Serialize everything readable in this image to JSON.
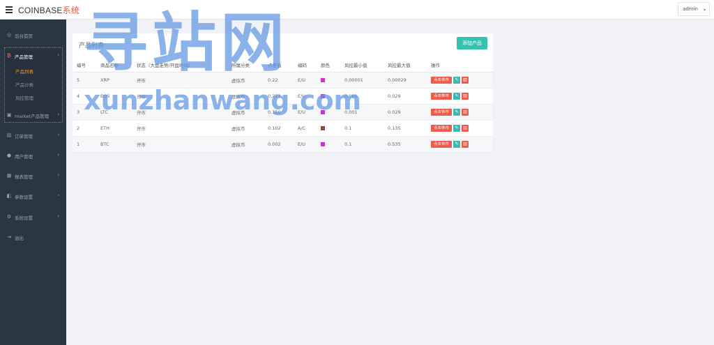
{
  "header": {
    "menu_icon": "hamburger-icon",
    "brand_en": "COINBASE",
    "brand_cn": "系统",
    "brand_cn_color": "#e8573f",
    "user": "admin"
  },
  "sidebar": {
    "items": [
      {
        "label": "后台首页",
        "icon": "dashboard-icon"
      },
      {
        "label": "产品管理",
        "icon": "bitcoin-icon",
        "active": true
      },
      {
        "label": "market产品管理",
        "icon": "stack-icon"
      },
      {
        "label": "订单管理",
        "icon": "orders-icon"
      },
      {
        "label": "用户管理",
        "icon": "user-icon"
      },
      {
        "label": "报表管理",
        "icon": "report-icon"
      },
      {
        "label": "参数设置",
        "icon": "params-icon"
      },
      {
        "label": "系统设置",
        "icon": "settings-icon"
      },
      {
        "label": "退出",
        "icon": "logout-icon"
      }
    ],
    "sub_items": [
      {
        "label": "产品列表",
        "current": true
      },
      {
        "label": "产品分类"
      },
      {
        "label": "风控管理"
      }
    ]
  },
  "panel": {
    "title": "产品列表",
    "add_button": "添加产品",
    "columns": [
      "编号",
      "商品名称",
      "状态（大盘走势/开盘时间）",
      "所属分类",
      "点差值",
      "编码",
      "颜色",
      "风控最小值",
      "风控最大值",
      "操作"
    ],
    "rows": [
      {
        "id": "5",
        "name": "XRP",
        "status": "开市",
        "category": "虚拟币",
        "spread": "0.22",
        "code": "E/U",
        "color": "#d82ad8",
        "risk_min": "0.00001",
        "risk_max": "0.00029"
      },
      {
        "id": "4",
        "name": "EOS",
        "status": "开市",
        "category": "虚拟币",
        "spread": "0.221",
        "code": "E/U",
        "color": "#d82ad8",
        "risk_min": "0.001",
        "risk_max": "0.029"
      },
      {
        "id": "3",
        "name": "LTC",
        "status": "开市",
        "category": "虚拟币",
        "spread": "0.150",
        "code": "E/U",
        "color": "#d82ad8",
        "risk_min": "0.001",
        "risk_max": "0.029"
      },
      {
        "id": "2",
        "name": "ETH",
        "status": "开市",
        "category": "虚拟币",
        "spread": "0.102",
        "code": "A/C",
        "color": "#8b4a3c",
        "risk_min": "0.1",
        "risk_max": "0.135"
      },
      {
        "id": "1",
        "name": "BTC",
        "status": "开市",
        "category": "虚拟币",
        "spread": "0.002",
        "code": "E/U",
        "color": "#d82ad8",
        "risk_min": "0.1",
        "risk_max": "0.535"
      }
    ],
    "row_action": "点击休市",
    "edit_icon": "pencil-icon",
    "delete_icon": "trash-icon"
  },
  "watermark": {
    "cn": "寻站网",
    "en": "xunzhanwang.com"
  }
}
